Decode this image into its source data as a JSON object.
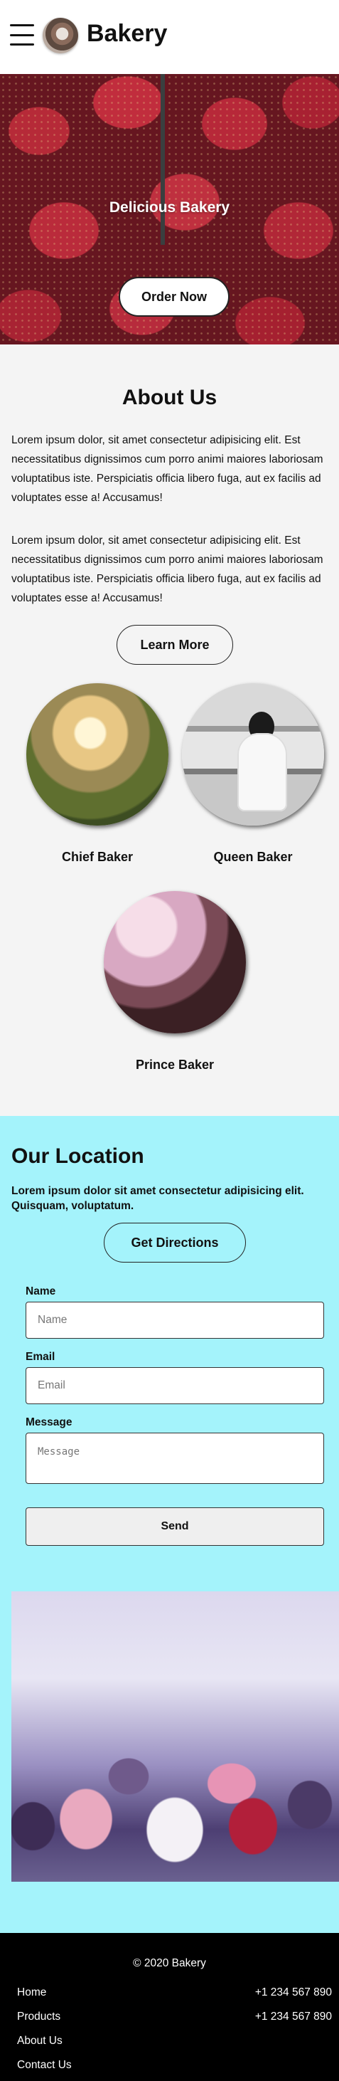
{
  "header": {
    "brand": "Bakery",
    "menu_icon": "hamburger-menu-icon",
    "logo_icon": "bakery-logo"
  },
  "hero": {
    "title": "Delicious Bakery",
    "order_button": "Order Now"
  },
  "about": {
    "title": "About Us",
    "paragraphs": [
      "Lorem ipsum dolor, sit amet consectetur adipisicing elit. Est necessitatibus dignissimos cum porro animi maiores laboriosam voluptatibus iste. Perspiciatis officia libero fuga, aut ex facilis ad voluptates esse a! Accusamus!",
      "Lorem ipsum dolor, sit amet consectetur adipisicing elit. Est necessitatibus dignissimos cum porro animi maiores laboriosam voluptatibus iste. Perspiciatis officia libero fuga, aut ex facilis ad voluptates esse a! Accusamus!"
    ],
    "learn_button": "Learn More",
    "bakers": [
      {
        "name": "Chief Baker"
      },
      {
        "name": "Queen Baker"
      },
      {
        "name": "Prince Baker"
      }
    ]
  },
  "location": {
    "title": "Our Location",
    "text": "Lorem ipsum dolor sit amet consectetur adipisicing elit. Quisquam, voluptatum.",
    "directions_button": "Get Directions",
    "form": {
      "name_label": "Name",
      "name_placeholder": "Name",
      "email_label": "Email",
      "email_placeholder": "Email",
      "message_label": "Message",
      "message_placeholder": "Message",
      "send_button": "Send"
    }
  },
  "footer": {
    "copyright": "© 2020 Bakery",
    "links": [
      "Home",
      "Products",
      "About Us",
      "Contact Us"
    ],
    "phones": [
      "+1 234 567 890",
      "+1 234 567 890"
    ]
  },
  "colors": {
    "location_bg": "#a4f3fb",
    "about_bg": "#f4f4f4",
    "footer_bg": "#000000"
  }
}
